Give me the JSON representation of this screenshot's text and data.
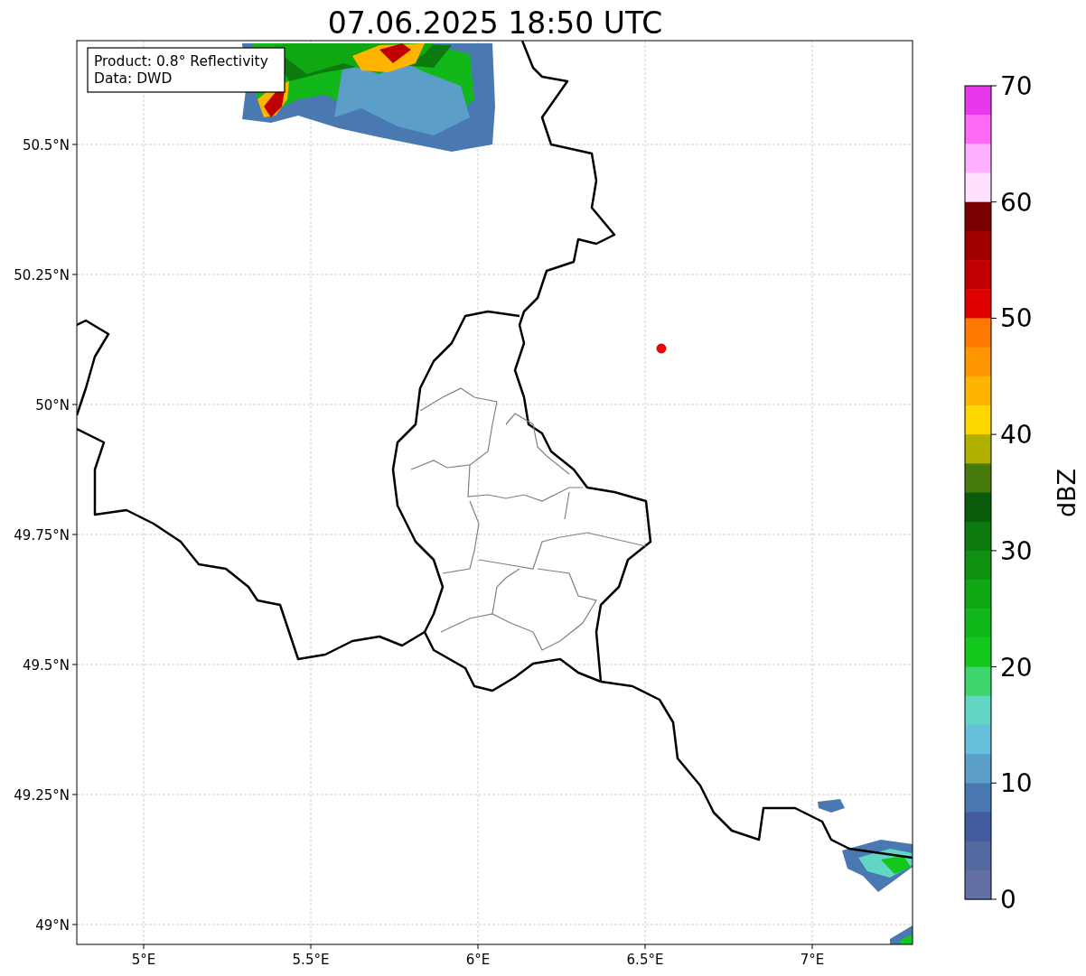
{
  "title": "07.06.2025 18:50 UTC",
  "legend": [
    "Product: 0.8° Reflectivity",
    "Data: DWD"
  ],
  "x_ticks": [
    "5°E",
    "5.5°E",
    "6°E",
    "6.5°E",
    "7°E"
  ],
  "y_ticks": [
    "50.5°N",
    "50.25°N",
    "50°N",
    "49.75°N",
    "49.5°N",
    "49.25°N",
    "49°N"
  ],
  "colorbar": {
    "label": "dBZ",
    "ticks": [
      "70",
      "60",
      "50",
      "40",
      "30",
      "20",
      "10",
      "0"
    ],
    "segments": [
      {
        "color": "#e838ec"
      },
      {
        "color": "#ff6af7"
      },
      {
        "color": "#ffb0ff"
      },
      {
        "color": "#ffe0ff"
      },
      {
        "color": "#780000"
      },
      {
        "color": "#a00000"
      },
      {
        "color": "#c00000"
      },
      {
        "color": "#e00000"
      },
      {
        "color": "#ff7800"
      },
      {
        "color": "#ff9600"
      },
      {
        "color": "#ffb400"
      },
      {
        "color": "#ffd700"
      },
      {
        "color": "#b0b000"
      },
      {
        "color": "#467a0a"
      },
      {
        "color": "#0a5c0c"
      },
      {
        "color": "#0c7a0e"
      },
      {
        "color": "#0e9010"
      },
      {
        "color": "#0fa812"
      },
      {
        "color": "#10b81a"
      },
      {
        "color": "#12c81a"
      },
      {
        "color": "#3ed46e"
      },
      {
        "color": "#62d6c4"
      },
      {
        "color": "#66c0dc"
      },
      {
        "color": "#5b9ec8"
      },
      {
        "color": "#4a78b0"
      },
      {
        "color": "#415da0"
      },
      {
        "color": "#5269a0"
      },
      {
        "color": "#6370a5"
      }
    ]
  }
}
